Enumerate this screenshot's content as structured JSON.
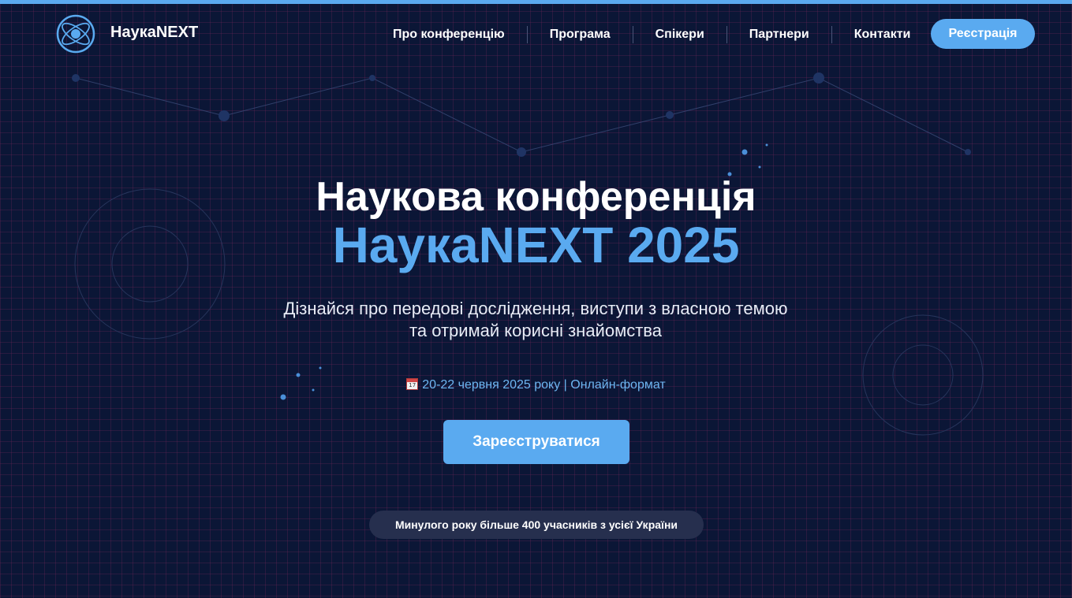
{
  "header": {
    "logo_text": "НаукаNEXT",
    "nav": [
      {
        "label": "Про конференцію"
      },
      {
        "label": "Програма"
      },
      {
        "label": "Спікери"
      },
      {
        "label": "Партнери"
      },
      {
        "label": "Контакти"
      }
    ],
    "register_label": "Реєстрація"
  },
  "hero": {
    "title_line1": "Наукова конференція",
    "title_line2": "НаукаNEXT 2025",
    "subtitle_line1": "Дізнайся про передові дослідження, виступи з власною темою",
    "subtitle_line2": "та отримай корисні знайомства",
    "date_info": "20-22 червня 2025 року | Онлайн-формат",
    "cta_label": "Зареєструватися",
    "badge_text": "Минулого року більше 400 учасників з усієї України"
  },
  "colors": {
    "background": "#0b1636",
    "accent": "#5aaaf0",
    "badge_bg": "#262f4e"
  },
  "icons": [
    "atom-logo-icon",
    "calendar-icon"
  ]
}
